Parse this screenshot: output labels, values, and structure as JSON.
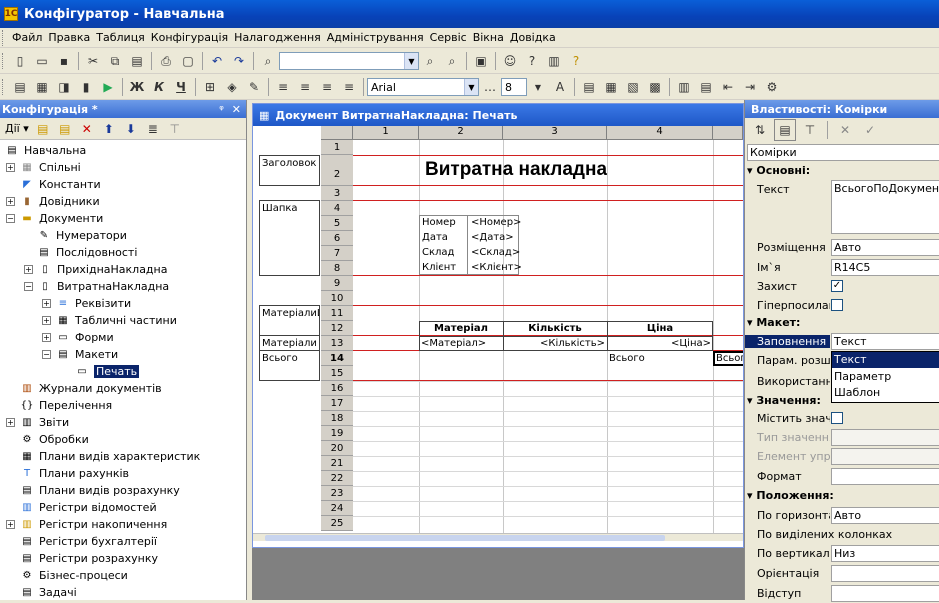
{
  "window": {
    "title": "Конфігуратор - Навчальна"
  },
  "menu": [
    "Файл",
    "Правка",
    "Таблиця",
    "Конфігурація",
    "Налагодження",
    "Адміністрування",
    "Сервіс",
    "Вікна",
    "Довідка"
  ],
  "format_toolbar": {
    "font": "Arial",
    "size": "8",
    "bold": "Ж",
    "italic": "К",
    "underline": "Ч"
  },
  "config_panel": {
    "title": "Конфігурація *",
    "actions_label": "Дії",
    "tree": [
      {
        "label": "Навчальна"
      },
      {
        "label": "Спільні"
      },
      {
        "label": "Константи"
      },
      {
        "label": "Довідники"
      },
      {
        "label": "Документи"
      },
      {
        "label": "Нумератори"
      },
      {
        "label": "Послідовності"
      },
      {
        "label": "ПрихіднаНакладна"
      },
      {
        "label": "ВитратнаНакладна"
      },
      {
        "label": "Реквізити"
      },
      {
        "label": "Табличні частини"
      },
      {
        "label": "Форми"
      },
      {
        "label": "Макети"
      },
      {
        "label": "Печать"
      },
      {
        "label": "Журнали документів"
      },
      {
        "label": "Перелічення"
      },
      {
        "label": "Звіти"
      },
      {
        "label": "Обробки"
      },
      {
        "label": "Плани видів характеристик"
      },
      {
        "label": "Плани рахунків"
      },
      {
        "label": "Плани видів розрахунку"
      },
      {
        "label": "Регістри відомостей"
      },
      {
        "label": "Регістри накопичення"
      },
      {
        "label": "Регістри бухгалтерії"
      },
      {
        "label": "Регістри розрахунку"
      },
      {
        "label": "Бізнес-процеси"
      },
      {
        "label": "Задачі"
      }
    ]
  },
  "doc_window": {
    "title": "Документ ВитратнаНакладна: Печать",
    "columns": [
      "1",
      "2",
      "3",
      "4"
    ],
    "rows": [
      "1",
      "2",
      "3",
      "4",
      "5",
      "6",
      "7",
      "8",
      "9",
      "10",
      "11",
      "12",
      "13",
      "14",
      "15",
      "16",
      "17",
      "18",
      "19",
      "20",
      "21",
      "22",
      "23",
      "24",
      "25"
    ],
    "groups": {
      "header": "Заголовок",
      "cap": "Шапка",
      "materials_header": "МатеріалиШ",
      "materials": "Матеріали",
      "total": "Всього"
    },
    "heading": "Витратна накладна",
    "fields": [
      {
        "label": "Номер",
        "value": "<Номер>"
      },
      {
        "label": "Дата",
        "value": "<Дата>"
      },
      {
        "label": "Склад",
        "value": "<Склад>"
      },
      {
        "label": "Клієнт",
        "value": "<Клієнт>"
      }
    ],
    "table_header": [
      "Матеріал",
      "Кількість",
      "Ціна"
    ],
    "table_row": [
      "<Матеріал>",
      "<Кількість>",
      "<Ціна>"
    ],
    "total_label": "Всього",
    "total_cell": "Всього"
  },
  "props_panel": {
    "title": "Властивості: Комірки",
    "object": "Комірки",
    "sections": {
      "basic": "Основні:",
      "layout": "Макет:",
      "values": "Значення:",
      "position": "Положення:"
    },
    "props": {
      "text_label": "Текст",
      "text_value": "ВсьогоПоДокументу",
      "placement_label": "Розміщення",
      "placement_value": "Авто",
      "name_label": "Ім`я",
      "name_value": "R14C5",
      "protect_label": "Захист",
      "hyperlink_label": "Гіперпосилання",
      "fill_label": "Заповнення",
      "fill_value": "Текст",
      "param_label": "Парам. розшифровки",
      "use_label": "Використання",
      "contains_label": "Містить значення",
      "value_type_label": "Тип значення",
      "element_label": "Елемент управління",
      "format_label": "Формат",
      "horiz_label": "По горизонталі",
      "horiz_value": "Авто",
      "by_cols_label": "По виділених колонках",
      "vert_label": "По вертикалі",
      "vert_value": "Низ",
      "orient_label": "Орієнтація",
      "indent_label": "Відступ"
    },
    "dropdown_options": [
      "Текст",
      "Параметр",
      "Шаблон"
    ]
  }
}
